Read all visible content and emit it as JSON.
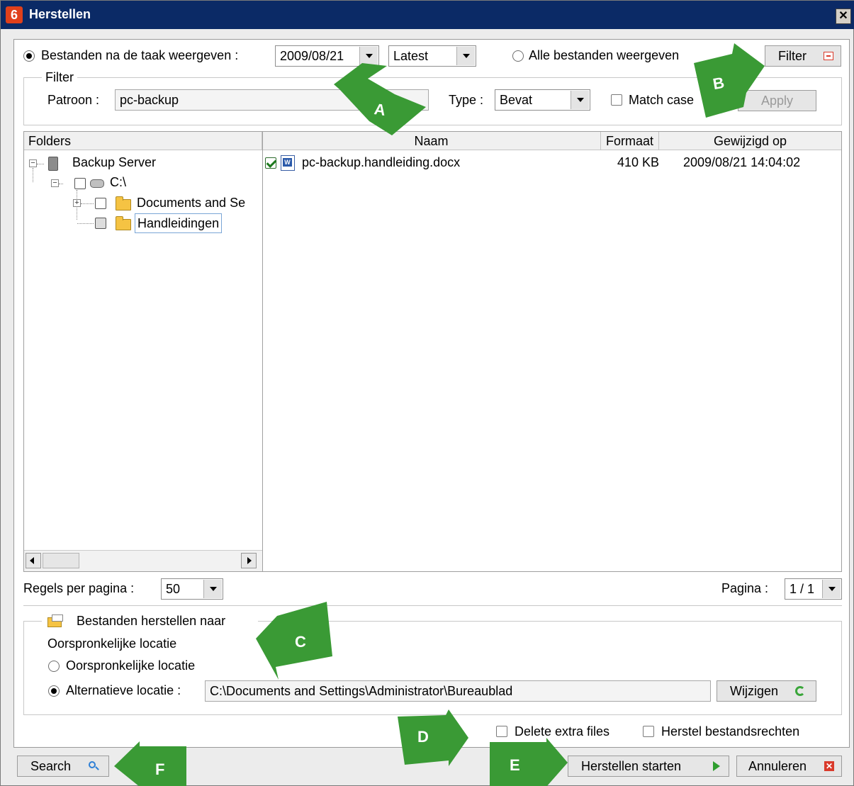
{
  "window": {
    "title": "Herstellen",
    "logo": "6",
    "close": "✕"
  },
  "toolbar": {
    "task_radio_label": "Bestanden na de taak weergeven :",
    "date_value": "2009/08/21",
    "version_value": "Latest",
    "all_radio_label": "Alle bestanden weergeven",
    "filter_button": "Filter"
  },
  "filter": {
    "legend": "Filter",
    "pattern_label": "Patroon :",
    "pattern_value": "pc-backup",
    "type_label": "Type :",
    "type_value": "Bevat",
    "match_case_label": "Match case",
    "apply_button": "Apply"
  },
  "folders": {
    "header": "Folders",
    "tree": [
      {
        "label": "Backup Server"
      },
      {
        "label": "C:\\"
      },
      {
        "label": "Documents and Se"
      },
      {
        "label": "Handleidingen"
      }
    ]
  },
  "files": {
    "columns": [
      "Naam",
      "Formaat",
      "Gewijzigd op"
    ],
    "rows": [
      {
        "name": "pc-backup.handleiding.docx",
        "size": "410 KB",
        "modified": "2009/08/21 14:04:02",
        "checked": true
      }
    ]
  },
  "paging": {
    "rows_label": "Regels per pagina :",
    "rows_value": "50",
    "page_label": "Pagina :",
    "page_value": "1 / 1"
  },
  "restore": {
    "legend": "Bestanden herstellen naar",
    "subtitle": "Oorspronkelijke locatie",
    "original_label": "Oorspronkelijke locatie",
    "alt_label": "Alternatieve locatie :",
    "alt_path": "C:\\Documents and Settings\\Administrator\\Bureaublad",
    "change_button": "Wijzigen"
  },
  "options": {
    "delete_extra": "Delete extra files",
    "restore_rights": "Herstel bestandsrechten"
  },
  "footer": {
    "search_button": "Search",
    "start_button": "Herstellen starten",
    "cancel_button": "Annuleren"
  },
  "annotations": [
    "A",
    "B",
    "C",
    "D",
    "E",
    "F"
  ],
  "colors": {
    "title_bar": "#0b2a66",
    "arrow": "#3a9a35",
    "accent_red": "#d93a2b"
  }
}
